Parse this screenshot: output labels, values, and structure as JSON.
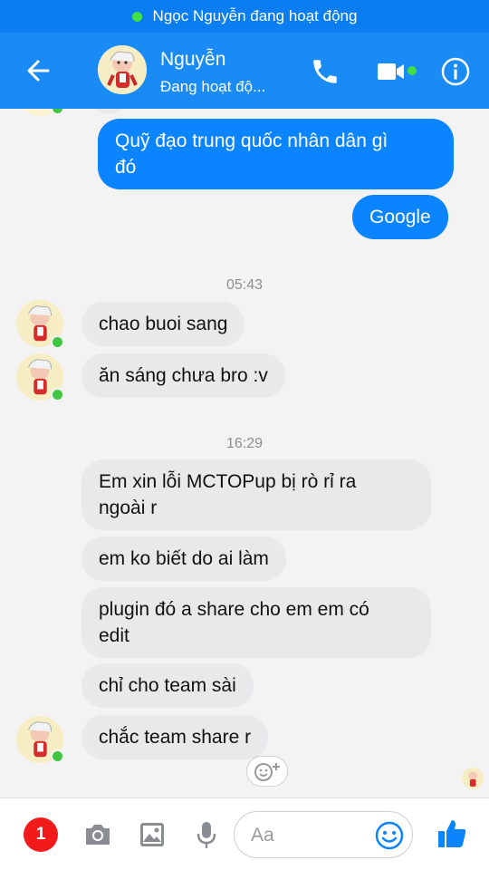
{
  "status_bar": {
    "text": "Ngọc Nguyễn đang hoạt động"
  },
  "header": {
    "name": "Nguyễn",
    "status": "Đang hoạt độ..."
  },
  "conversation": {
    "outgoing": [
      {
        "text_line1": "Quỹ đạo trung quốc nhân dân gì",
        "text_line2": "đó"
      },
      {
        "text": "Google"
      }
    ],
    "timestamps": [
      "05:43",
      "16:29"
    ],
    "incoming_group1": [
      "chao buoi sang",
      "ăn sáng chưa bro :v"
    ],
    "incoming_group2": [
      {
        "line1": "Em xin lỗi MCTOPup bị rò rỉ ra",
        "line2": "ngoài r"
      },
      {
        "line1": "em ko biết do ai làm"
      },
      {
        "line1": "plugin đó a share cho em em có",
        "line2": "edit"
      },
      {
        "line1": "chỉ cho team sài"
      },
      {
        "line1": "chắc team share r"
      }
    ]
  },
  "composer": {
    "badge_count": "1",
    "placeholder": "Aa"
  },
  "colors": {
    "header_blue": "#1a8bf5",
    "outgoing_bubble": "#0a84ff",
    "incoming_bubble": "#e9e9eb",
    "online_green": "#42c542",
    "badge_red": "#f21b1b"
  },
  "icons": {
    "back": "back-arrow-icon",
    "call": "phone-icon",
    "video": "video-camera-icon",
    "info": "info-icon",
    "camera": "camera-icon",
    "gallery": "image-icon",
    "mic": "microphone-icon",
    "emoji": "smiley-icon",
    "like": "thumbs-up-icon",
    "react": "add-reaction-icon"
  }
}
